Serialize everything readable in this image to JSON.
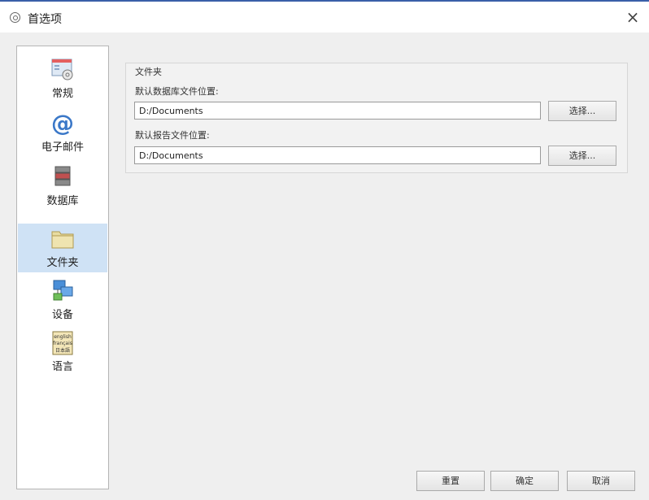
{
  "window": {
    "title": "首选项",
    "close_glyph": "×"
  },
  "sidebar": {
    "items": [
      {
        "label": "常规",
        "icon": "general-settings-icon"
      },
      {
        "label": "电子邮件",
        "icon": "email-at-icon"
      },
      {
        "label": "数据库",
        "icon": "database-icon"
      },
      {
        "label": "文件夹",
        "icon": "folder-icon",
        "selected": true
      },
      {
        "label": "设备",
        "icon": "devices-icon"
      },
      {
        "label": "语言",
        "icon": "language-icon",
        "icon_text": [
          "english",
          "français",
          "日本語"
        ]
      }
    ]
  },
  "folders": {
    "group_title": "文件夹",
    "database_label": "默认数据库文件位置:",
    "database_value": "D:/Documents",
    "report_label": "默认报告文件位置:",
    "report_value": "D:/Documents",
    "choose_label": "选择..."
  },
  "footer": {
    "reset_label": "重置",
    "ok_label": "确定",
    "cancel_label": "取消"
  },
  "colors": {
    "selected_bg": "#cfe2f5",
    "title_accent": "#3a5fa8"
  }
}
